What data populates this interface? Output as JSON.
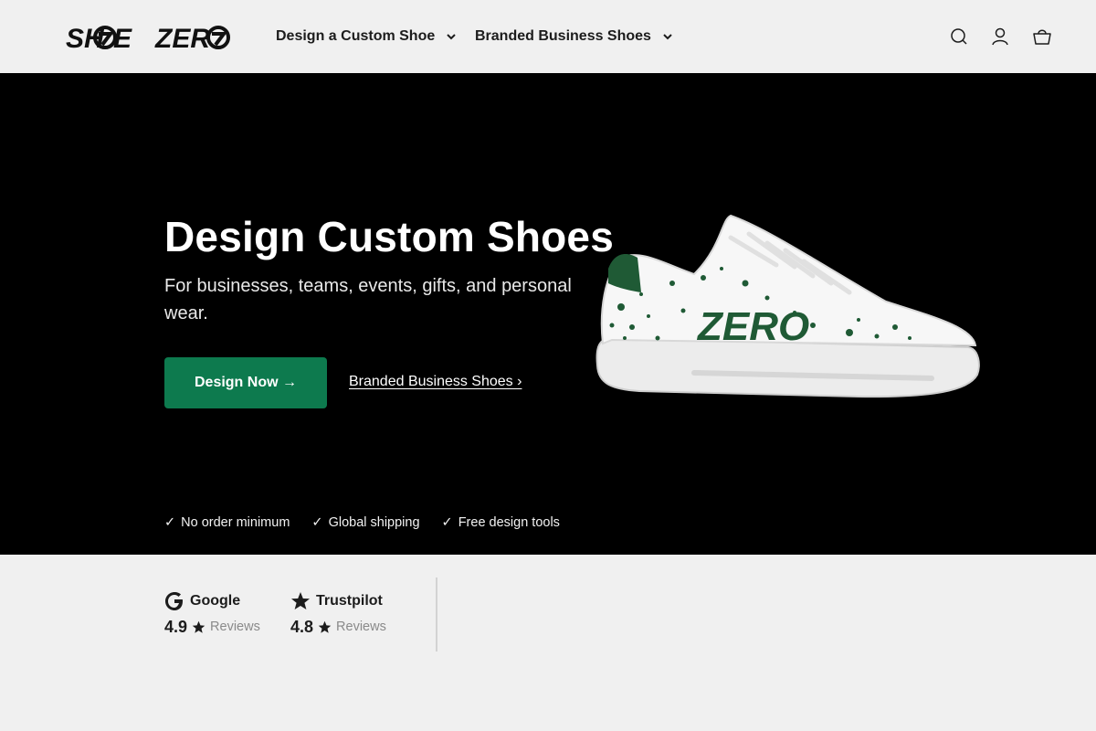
{
  "brand": {
    "logo_text": "SHOE ZERO",
    "accent_color": "#0d7a4e"
  },
  "nav": {
    "items": [
      {
        "label": "Design a Custom Shoe",
        "icon": "chevron-down-icon"
      },
      {
        "label": "Branded Business Shoes",
        "icon": "chevron-down-icon"
      }
    ],
    "icons": [
      "search-icon",
      "account-icon",
      "cart-icon"
    ]
  },
  "hero": {
    "title": "Design Custom Shoes",
    "subtitle": "For businesses, teams, events, gifts, and personal wear.",
    "primary_button": "Design Now →",
    "secondary_link": "Branded Business Shoes ›",
    "shoe_brand_text": "ZERO",
    "perks": [
      {
        "check": "✓",
        "label": "No order minimum"
      },
      {
        "check": "✓",
        "label": "Global shipping"
      },
      {
        "check": "✓",
        "label": "Free design tools"
      }
    ]
  },
  "reviews": [
    {
      "source": "Google",
      "score": "4.9",
      "label": "Reviews",
      "icon": "google-icon"
    },
    {
      "source": "Trustpilot",
      "score": "4.8",
      "label": "Reviews",
      "icon": "trustpilot-star-icon"
    }
  ]
}
